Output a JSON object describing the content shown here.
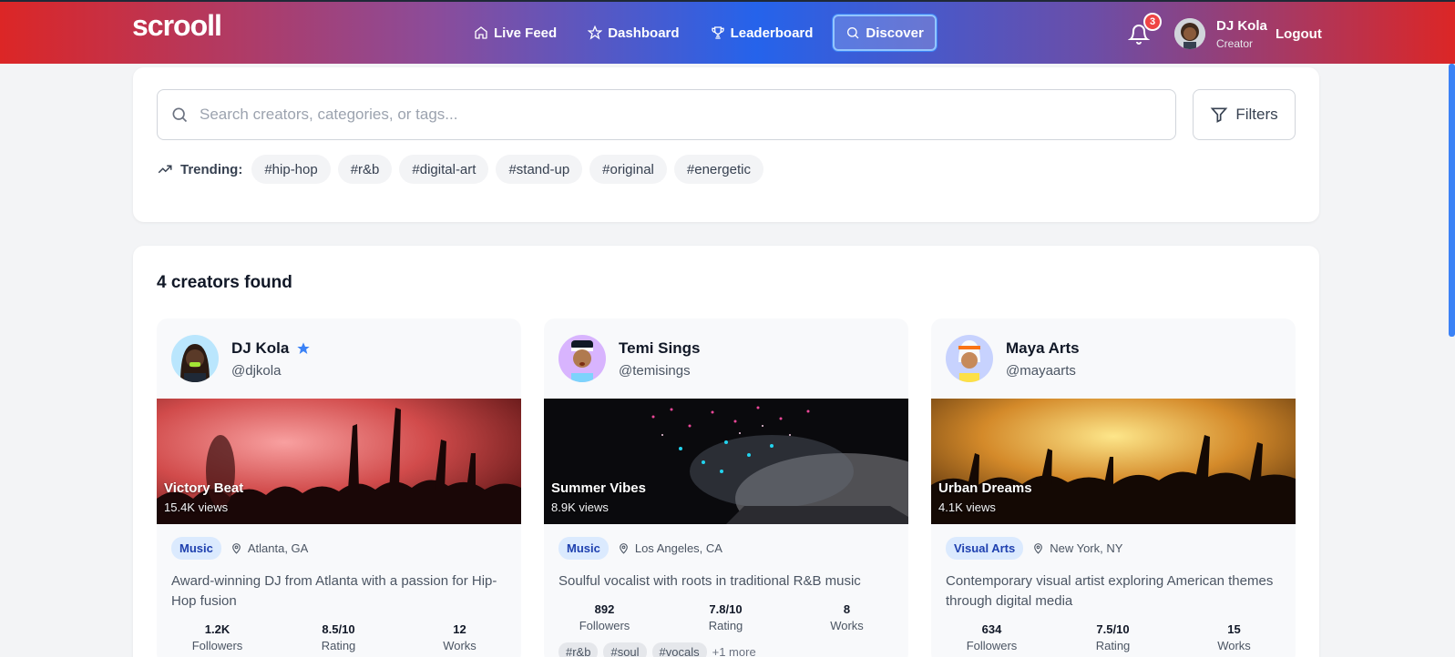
{
  "app": {
    "logo": "scrooll",
    "nav": [
      {
        "label": "Live Feed",
        "icon": "home-icon"
      },
      {
        "label": "Dashboard",
        "icon": "star-icon"
      },
      {
        "label": "Leaderboard",
        "icon": "trophy-icon"
      },
      {
        "label": "Discover",
        "icon": "search-icon",
        "active": true
      }
    ],
    "notifications_count": "3",
    "user": {
      "name": "DJ Kola",
      "role": "Creator"
    },
    "logout_label": "Logout"
  },
  "search": {
    "placeholder": "Search creators, categories, or tags...",
    "value": "",
    "filters_label": "Filters",
    "trending_label": "Trending:",
    "trending_tags": [
      "#hip-hop",
      "#r&b",
      "#digital-art",
      "#stand-up",
      "#original",
      "#energetic"
    ]
  },
  "results": {
    "count_label": "4 creators found",
    "creators": [
      {
        "name": "DJ Kola",
        "handle": "@djkola",
        "verified": true,
        "work_title": "Victory Beat",
        "work_views": "15.4K views",
        "category": "Music",
        "location": "Atlanta, GA",
        "bio": "Award-winning DJ from Atlanta with a passion for Hip-Hop fusion",
        "stats": [
          {
            "value": "1.2K",
            "label": "Followers"
          },
          {
            "value": "8.5/10",
            "label": "Rating"
          },
          {
            "value": "12",
            "label": "Works"
          }
        ],
        "tags": []
      },
      {
        "name": "Temi Sings",
        "handle": "@temisings",
        "verified": false,
        "work_title": "Summer Vibes",
        "work_views": "8.9K views",
        "category": "Music",
        "location": "Los Angeles, CA",
        "bio": "Soulful vocalist with roots in traditional R&B music",
        "stats": [
          {
            "value": "892",
            "label": "Followers"
          },
          {
            "value": "7.8/10",
            "label": "Rating"
          },
          {
            "value": "8",
            "label": "Works"
          }
        ],
        "tags": [
          "#r&b",
          "#soul",
          "#vocals"
        ],
        "more_tags": "+1 more"
      },
      {
        "name": "Maya Arts",
        "handle": "@mayaarts",
        "verified": false,
        "work_title": "Urban Dreams",
        "work_views": "4.1K views",
        "category": "Visual Arts",
        "location": "New York, NY",
        "bio": "Contemporary visual artist exploring American themes through digital media",
        "stats": [
          {
            "value": "634",
            "label": "Followers"
          },
          {
            "value": "7.5/10",
            "label": "Rating"
          },
          {
            "value": "15",
            "label": "Works"
          }
        ],
        "tags": []
      }
    ]
  }
}
